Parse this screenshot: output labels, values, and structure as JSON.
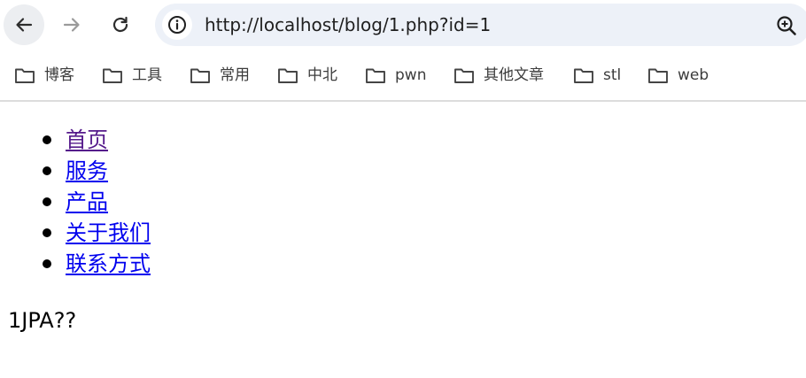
{
  "browser": {
    "url": "http://localhost/blog/1.php?id=1",
    "bookmarks": [
      {
        "label": "博客"
      },
      {
        "label": "工具"
      },
      {
        "label": "常用"
      },
      {
        "label": "中北"
      },
      {
        "label": "pwn"
      },
      {
        "label": "其他文章"
      },
      {
        "label": "stl"
      },
      {
        "label": "web"
      }
    ]
  },
  "page": {
    "nav": [
      {
        "label": "首页"
      },
      {
        "label": "服务"
      },
      {
        "label": "产品"
      },
      {
        "label": "关于我们"
      },
      {
        "label": "联系方式"
      }
    ],
    "body_text": "1JPA??"
  },
  "colors": {
    "visited_link": "#551a8b",
    "link": "#0000ee",
    "omnibox_bg": "#edf1f8"
  }
}
